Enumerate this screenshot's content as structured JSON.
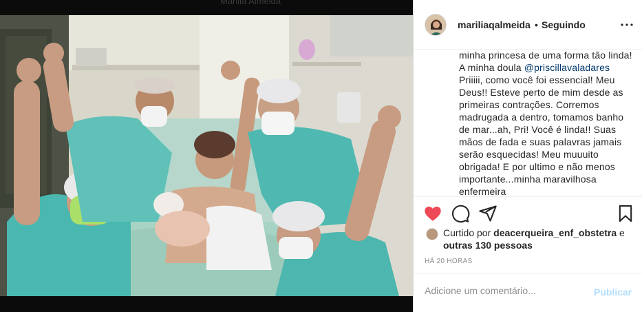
{
  "photo": {
    "ghost_text": "Marilia Almeida",
    "alt": "Grupo comemorando com bebê recém-nascido no hospital"
  },
  "post": {
    "username": "mariliaqalmeida",
    "separator": "•",
    "follow_status": "Seguindo",
    "caption_lines": [
      "minha princesa de uma forma tão linda!",
      "A minha doula ",
      "Priiiii, como você foi essencial! Meu",
      "Deus!! Esteve perto de mim desde as",
      "primeiras contrações. Corremos",
      "madrugada a dentro, tomamos banho",
      "de mar...ah, Pri! Você é linda!! Suas",
      "mãos de fada e suas palavras jamais",
      "serão esquecidas! Meu muuuito",
      "obrigada! E por ultimo e não menos",
      "importante...minha maravilhosa",
      "enfermeira"
    ],
    "mention": "@priscillavaladares",
    "likes_prefix": "Curtido por ",
    "liker": "deacerqueira_enf_obstetra",
    "likes_conjunction": " e",
    "likes_others": "outras 130 pessoas",
    "timestamp": "HÁ 20 HORAS",
    "comment_placeholder": "Adicione um comentário...",
    "publish_label": "Publicar"
  },
  "icons": {
    "like": "heart-icon",
    "comment": "comment-icon",
    "share": "share-icon",
    "save": "bookmark-icon",
    "more": "more-icon"
  },
  "colors": {
    "heart": "#ed4956",
    "mention": "#00376b",
    "publish": "#b2dffc",
    "muted": "#8e8e8e"
  }
}
